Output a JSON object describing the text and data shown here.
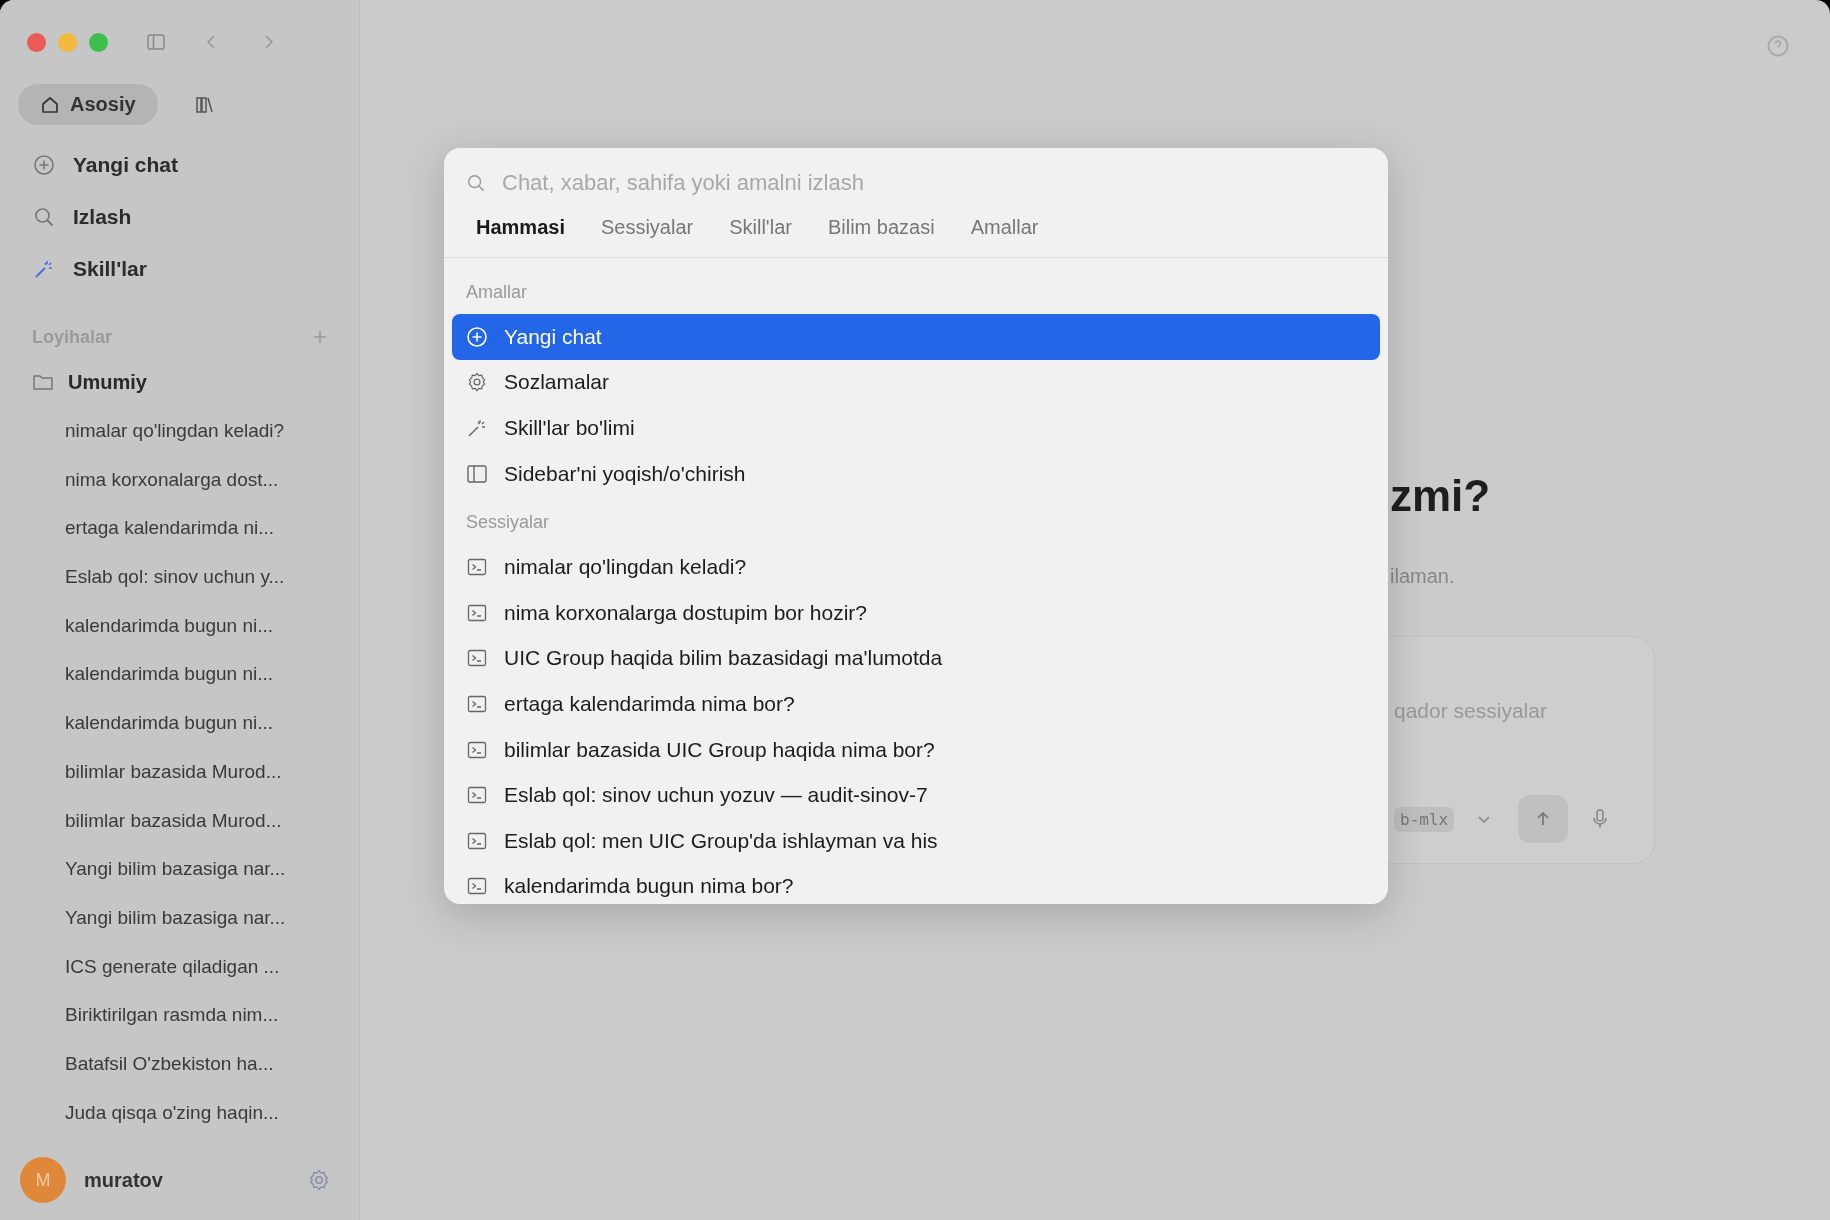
{
  "sidebar": {
    "nav_tabs": [
      {
        "kind": "home",
        "label": "Asosiy",
        "selected": true
      },
      {
        "kind": "library",
        "selected": false
      }
    ],
    "nav_items": [
      {
        "kind": "new",
        "label": "Yangi chat"
      },
      {
        "kind": "search",
        "label": "Izlash"
      },
      {
        "kind": "skills",
        "label": "Skill'lar"
      }
    ],
    "projects": {
      "title": "Loyihalar",
      "folders": [
        {
          "name": "Umumiy",
          "sessions": [
            "nimalar qo'lingdan keladi?",
            "nima korxonalarga dost...",
            "ertaga kalendarimda ni...",
            "Eslab qol: sinov uchun y...",
            "kalendarimda bugun ni...",
            "kalendarimda bugun ni...",
            "kalendarimda bugun ni...",
            "bilimlar bazasida Murod...",
            "bilimlar bazasida Murod...",
            "Yangi bilim bazasiga nar...",
            "Yangi bilim bazasiga nar...",
            "ICS generate qiladigan ...",
            "Biriktirilgan rasmda nim...",
            "Batafsil O'zbekiston ha...",
            "Juda qisqa o'zing haqin..."
          ]
        }
      ]
    },
    "user": {
      "initial": "M",
      "name": "muratov"
    }
  },
  "main": {
    "heading": "zmi?",
    "subtitle": "ilaman.",
    "composer": {
      "text": "qador sessiyalar",
      "model_chip": "b-mlx"
    }
  },
  "palette": {
    "placeholder": "Chat, xabar, sahifa yoki amalni izlash",
    "tabs": [
      {
        "label": "Hammasi",
        "selected": true
      },
      {
        "label": "Sessiyalar",
        "selected": false
      },
      {
        "label": "Skill'lar",
        "selected": false
      },
      {
        "label": "Bilim bazasi",
        "selected": false
      },
      {
        "label": "Amallar",
        "selected": false
      }
    ],
    "sections": [
      {
        "title": "Amallar",
        "items": [
          {
            "kind": "new",
            "label": "Yangi chat",
            "selected": true
          },
          {
            "kind": "settings",
            "label": "Sozlamalar",
            "selected": false
          },
          {
            "kind": "skills",
            "label": "Skill'lar bo'limi",
            "selected": false
          },
          {
            "kind": "sidebar",
            "label": "Sidebar'ni yoqish/o'chirish",
            "selected": false
          }
        ]
      },
      {
        "title": "Sessiyalar",
        "items": [
          {
            "kind": "session",
            "label": "nimalar qo'lingdan keladi?",
            "selected": false
          },
          {
            "kind": "session",
            "label": "nima korxonalarga dostupim bor hozir?",
            "selected": false
          },
          {
            "kind": "session",
            "label": "UIC Group haqida bilim bazasidagi ma'lumotda",
            "selected": false
          },
          {
            "kind": "session",
            "label": "ertaga kalendarimda nima bor?",
            "selected": false
          },
          {
            "kind": "session",
            "label": "bilimlar bazasida UIC Group haqida nima bor?",
            "selected": false
          },
          {
            "kind": "session",
            "label": "Eslab qol: sinov uchun yozuv — audit-sinov-7",
            "selected": false
          },
          {
            "kind": "session",
            "label": "Eslab qol: men UIC Group'da ishlayman va his",
            "selected": false
          },
          {
            "kind": "session",
            "label": "kalendarimda bugun nima bor?",
            "selected": false
          }
        ]
      }
    ]
  }
}
